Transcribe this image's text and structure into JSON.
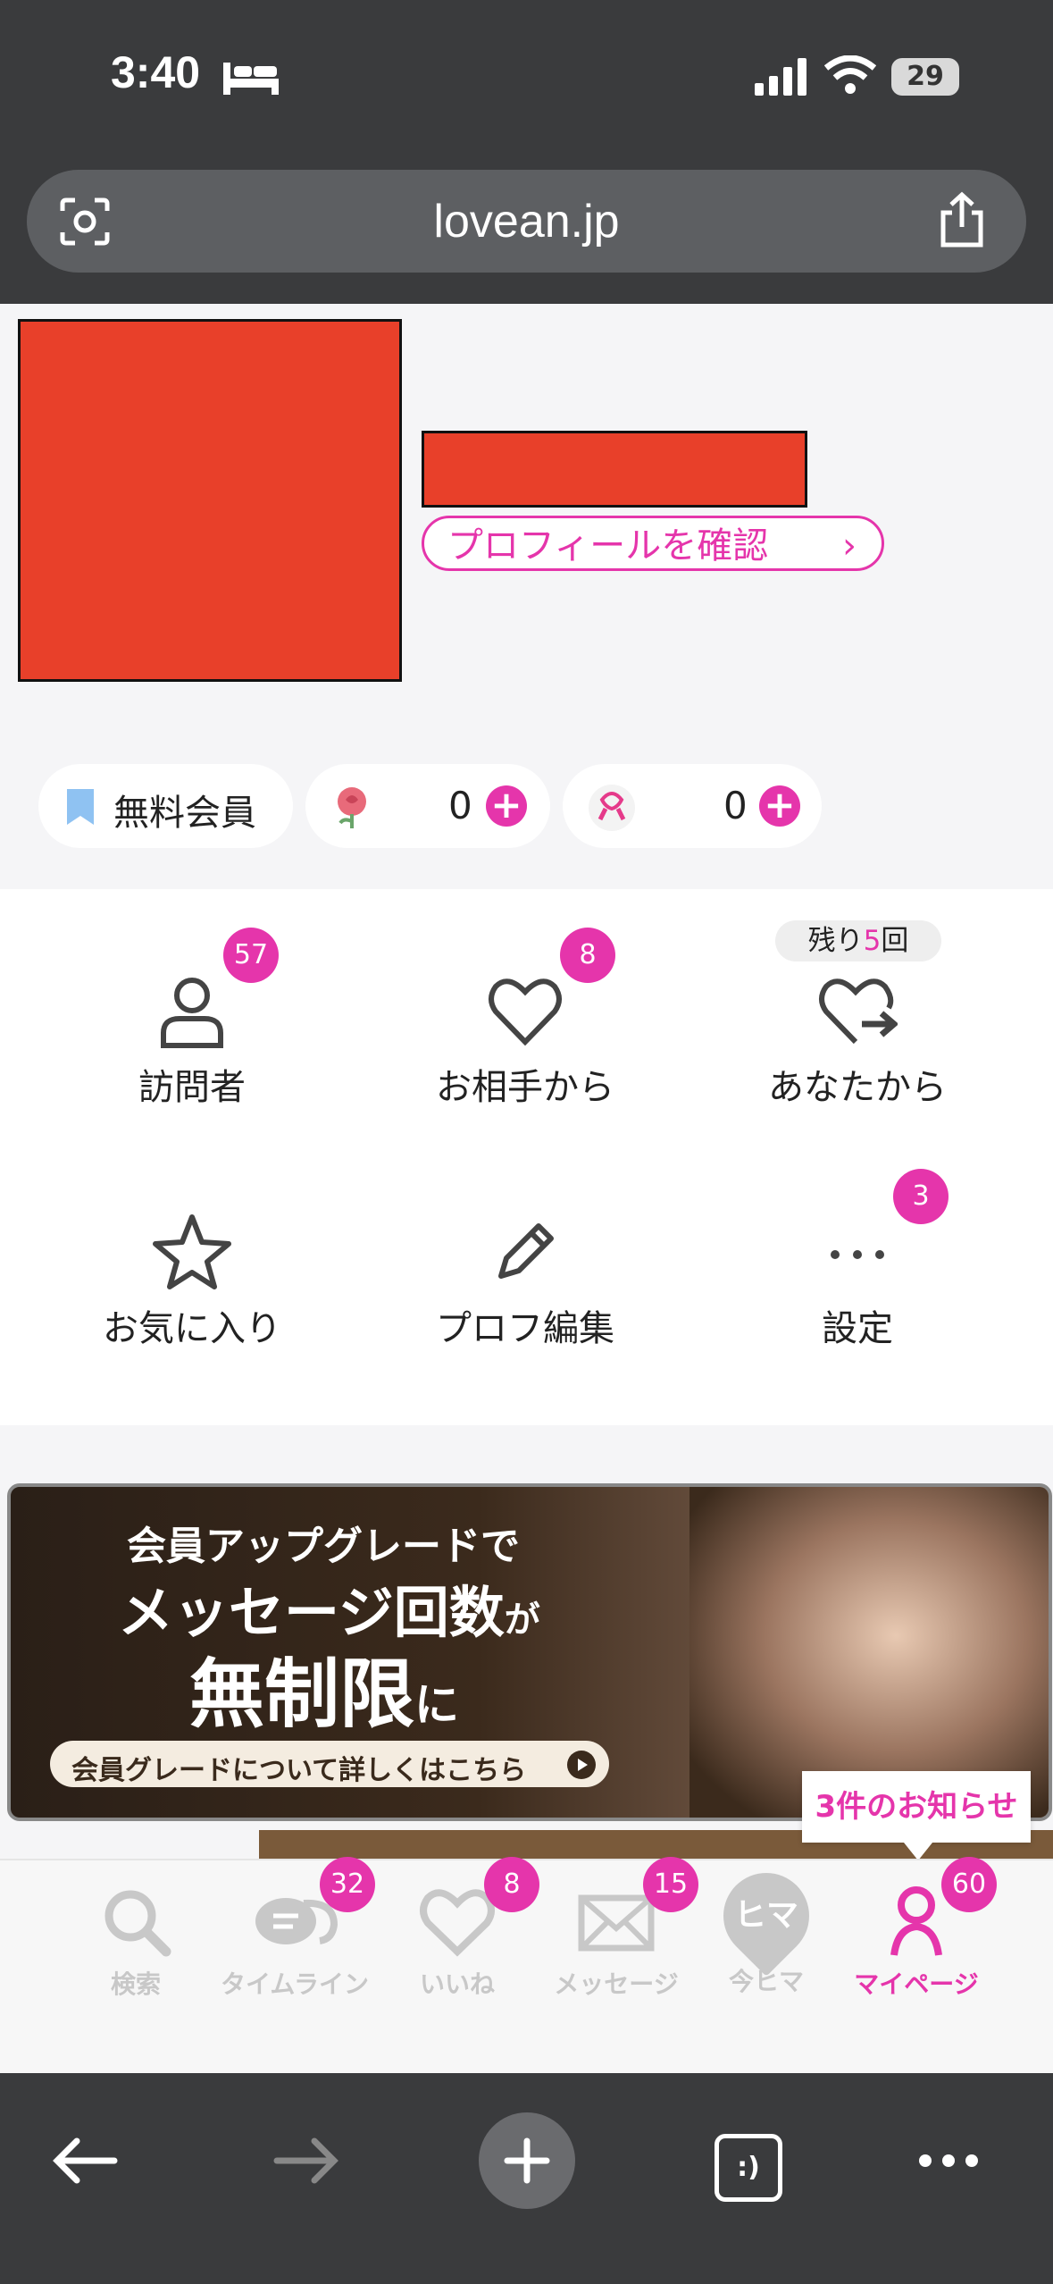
{
  "status_bar": {
    "time": "3:40",
    "battery": "29"
  },
  "browser": {
    "url": "lovean.jp"
  },
  "profile": {
    "confirm_label": "プロフィールを確認",
    "membership": "無料会員",
    "rose_count": "0",
    "ribbon_count": "0"
  },
  "menu": {
    "items": [
      {
        "label": "訪問者",
        "badge": "57"
      },
      {
        "label": "お相手から",
        "badge": "8"
      },
      {
        "label": "あなたから",
        "note_prefix": "残り",
        "note_count": "5",
        "note_suffix": "回"
      },
      {
        "label": "お気に入り"
      },
      {
        "label": "プロフ編集"
      },
      {
        "label": "設定",
        "badge": "3"
      }
    ]
  },
  "banner": {
    "line1": "会員アップグレードで",
    "line2a": "メッセージ回数",
    "line2b": "が",
    "line3a": "無制限",
    "line3b": "に",
    "cta": "会員グレードについて詳しくはこちら"
  },
  "notice_tooltip": "3件のお知らせ",
  "tabbar": {
    "tabs": [
      {
        "label": "検索"
      },
      {
        "label": "タイムライン",
        "badge": "32"
      },
      {
        "label": "いいね",
        "badge": "8"
      },
      {
        "label": "メッセージ",
        "badge": "15"
      },
      {
        "label": "今ヒマ",
        "icon_text": "ヒマ"
      },
      {
        "label": "マイページ",
        "badge": "60"
      }
    ]
  },
  "colors": {
    "accent": "#e535ab",
    "status_bg": "#3a3b3d",
    "redaction": "#e8402a"
  }
}
